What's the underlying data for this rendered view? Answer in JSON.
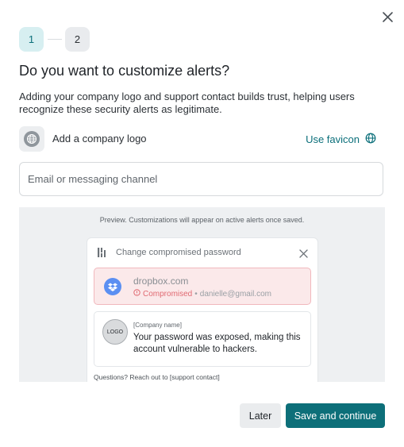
{
  "stepper": {
    "steps": [
      "1",
      "2"
    ],
    "active": 1
  },
  "header": {
    "title": "Do you want to customize alerts?",
    "description": "Adding your company logo and support contact builds trust, helping users recognize these security alerts as legitimate."
  },
  "logo_row": {
    "label": "Add a company logo",
    "favicon_link": "Use favicon"
  },
  "contact_input": {
    "placeholder": "Email or messaging channel",
    "value": ""
  },
  "preview": {
    "note": "Preview. Customizations will appear on active alerts once saved.",
    "card": {
      "title": "Change compromised password",
      "site": {
        "name": "dropbox.com",
        "status": "Compromised",
        "separator": "•",
        "email": "danielle@gmail.com"
      },
      "logo_placeholder": "LOGO",
      "company_name": "[Company name]",
      "message": "Your password was exposed, making this account vulnerable to hackers.",
      "questions": "Questions? Reach out to [support contact]"
    }
  },
  "buttons": {
    "later": "Later",
    "save": "Save and continue"
  },
  "colors": {
    "accent": "#0d6f79",
    "danger": "#e06a72",
    "step_active_bg": "#d7eff1"
  },
  "icons": [
    "close-icon",
    "globe-icon",
    "brand-icon",
    "dropbox-icon",
    "alert-circle-icon"
  ]
}
